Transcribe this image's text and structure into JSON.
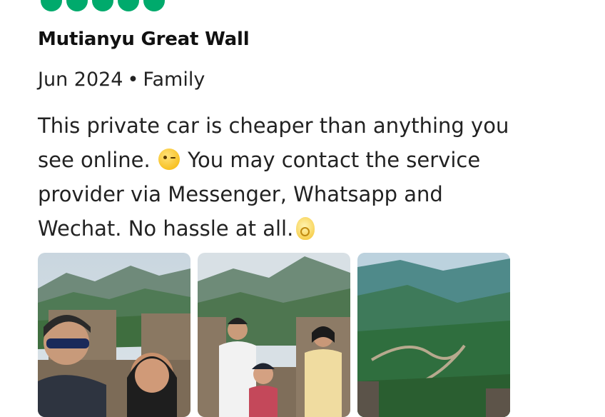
{
  "review": {
    "rating_bubbles": 5,
    "rating_color": "#00aa6c",
    "title": "Mutianyu Great Wall",
    "date": "Jun 2024",
    "separator": "•",
    "trip_type": "Family",
    "body_lines": [
      "This private car is cheaper than anything you",
      "see online.",
      "You may contact the service",
      "provider via Messenger, Whatsapp and",
      "Wechat. No hassle at all."
    ],
    "emojis": [
      "winking-face",
      "ok-hand"
    ]
  },
  "photos": [
    {
      "name": "photo-family-selfie-wall"
    },
    {
      "name": "photo-kids-on-wall"
    },
    {
      "name": "photo-wall-landscape"
    }
  ]
}
